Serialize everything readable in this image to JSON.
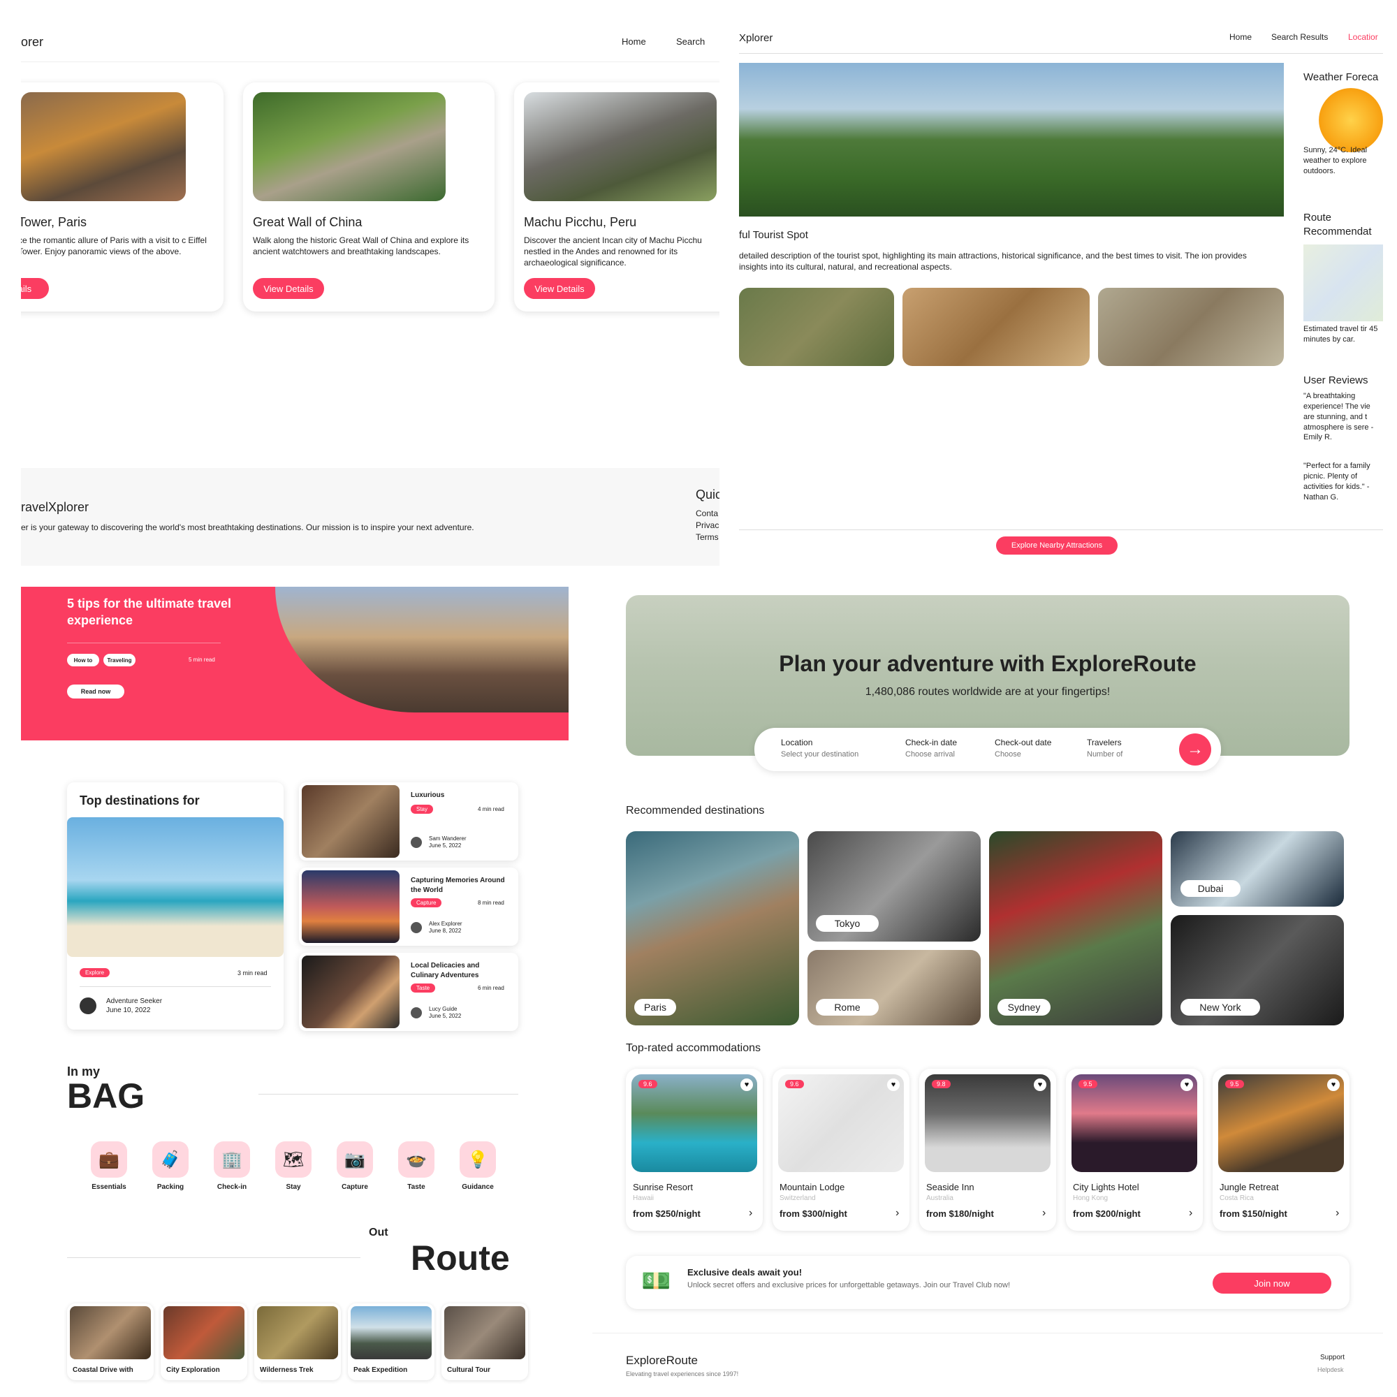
{
  "p1": {
    "brand": "orer",
    "nav": [
      "Home",
      "Search"
    ],
    "cards": [
      {
        "title": "Tower, Paris",
        "desc": "ce the romantic allure of Paris with a visit to c Eiffel Tower. Enjoy panoramic views of the above.",
        "button": "etails"
      },
      {
        "title": "Great Wall of China",
        "desc": "Walk along the historic Great Wall of China and explore its ancient watchtowers and breathtaking landscapes.",
        "button": "View Details"
      },
      {
        "title": "Machu Picchu, Peru",
        "desc": "Discover the ancient Incan city of Machu Picchu nestled in the Andes and renowned for its archaeological significance.",
        "button": "View Details"
      }
    ],
    "footer": {
      "brand": "ravelXplorer",
      "mission": "er is your gateway to discovering the world's most breathtaking destinations. Our mission is to inspire your next adventure.",
      "quick_title": "Quic",
      "quick_links": [
        "Conta",
        "Privac",
        "Terms"
      ]
    }
  },
  "p2": {
    "brand": "Xplorer",
    "nav": [
      "Home",
      "Search Results",
      "Locatior"
    ],
    "spot_title": "ful Tourist Spot",
    "spot_desc": "detailed description of the tourist spot, highlighting its main attractions, historical significance, and the best times to visit. The ion provides insights into its cultural, natural, and recreational aspects.",
    "weather_title": "Weather Foreca",
    "weather_text": "Sunny, 24°C. Ideal weather to explore outdoors.",
    "route_title": "Route Recommendat",
    "route_text": "Estimated travel tir 45 minutes by car.",
    "reviews_title": "User Reviews",
    "review1": "\"A breathtaking experience! The vie are stunning, and t atmosphere is sere - Emily R.",
    "review2": "\"Perfect for a family picnic. Plenty of activities for kids.\" - Nathan G.",
    "cta": "Explore Nearby Attractions"
  },
  "p3": {
    "hero_sub": "5 tips for the ultimate travel experience",
    "tags": [
      "How to",
      "Traveling"
    ],
    "read_time": "5 min read",
    "read_now": "Read now",
    "top_title": "Top destinations for",
    "top_tag": "Explore",
    "top_time": "3 min read",
    "top_author": "Adventure Seeker",
    "top_date": "June 10, 2022",
    "articles": [
      {
        "title": "Luxurious",
        "tag": "Stay",
        "time": "4 min read",
        "author": "Sam Wanderer",
        "date": "June 5, 2022"
      },
      {
        "title": "Capturing Memories Around the World",
        "tag": "Capture",
        "time": "8 min read",
        "author": "Alex Explorer",
        "date": "June 8, 2022"
      },
      {
        "title": "Local Delicacies and Culinary Adventures",
        "tag": "Taste",
        "time": "6 min read",
        "author": "Lucy Guide",
        "date": "June 5, 2022"
      }
    ],
    "bag_small": "In my",
    "bag_big": "BAG",
    "categories": [
      {
        "label": "Essentials",
        "icon": "bag-icon"
      },
      {
        "label": "Packing",
        "icon": "suitcase-icon"
      },
      {
        "label": "Check-in",
        "icon": "hotel-icon"
      },
      {
        "label": "Stay",
        "icon": "map-icon"
      },
      {
        "label": "Capture",
        "icon": "camera-icon"
      },
      {
        "label": "Taste",
        "icon": "food-icon"
      },
      {
        "label": "Guidance",
        "icon": "bulb-icon"
      }
    ],
    "route_small": "Out",
    "route_big": "Route",
    "routes": [
      "Coastal Drive with",
      "City Exploration",
      "Wilderness Trek",
      "Peak Expedition",
      "Cultural Tour"
    ]
  },
  "p4": {
    "hero_title": "Plan your adventure with ExploreRoute",
    "hero_sub": "1,480,086 routes worldwide are at your fingertips!",
    "search": [
      {
        "label": "Location",
        "placeholder": "Select your destination"
      },
      {
        "label": "Check-in date",
        "placeholder": "Choose arrival"
      },
      {
        "label": "Check-out date",
        "placeholder": "Choose"
      },
      {
        "label": "Travelers",
        "placeholder": "Number of"
      }
    ],
    "rec_title": "Recommended destinations",
    "destinations": [
      "Paris",
      "Tokyo",
      "Rome",
      "Sydney",
      "Dubai",
      "New York"
    ],
    "acc_title": "Top-rated accommodations",
    "accommodations": [
      {
        "score": "9.6",
        "name": "Sunrise Resort",
        "loc": "Hawaii",
        "price": "from $250/night"
      },
      {
        "score": "9.6",
        "name": "Mountain Lodge",
        "loc": "Switzerland",
        "price": "from $300/night"
      },
      {
        "score": "9.8",
        "name": "Seaside Inn",
        "loc": "Australia",
        "price": "from $180/night"
      },
      {
        "score": "9.5",
        "name": "City Lights Hotel",
        "loc": "Hong Kong",
        "price": "from $200/night"
      },
      {
        "score": "9.5",
        "name": "Jungle Retreat",
        "loc": "Costa Rica",
        "price": "from $150/night"
      }
    ],
    "deal_title": "Exclusive deals await you!",
    "deal_text": "Unlock secret offers and exclusive prices for unforgettable getaways. Join our Travel Club now!",
    "join": "Join now",
    "footer_brand": "ExploreRoute",
    "footer_tag": "Elevating travel experiences since 1997!",
    "support": "Support",
    "helpdesk": "Helpdesk"
  },
  "colors": {
    "accent": "#fb3d61"
  }
}
